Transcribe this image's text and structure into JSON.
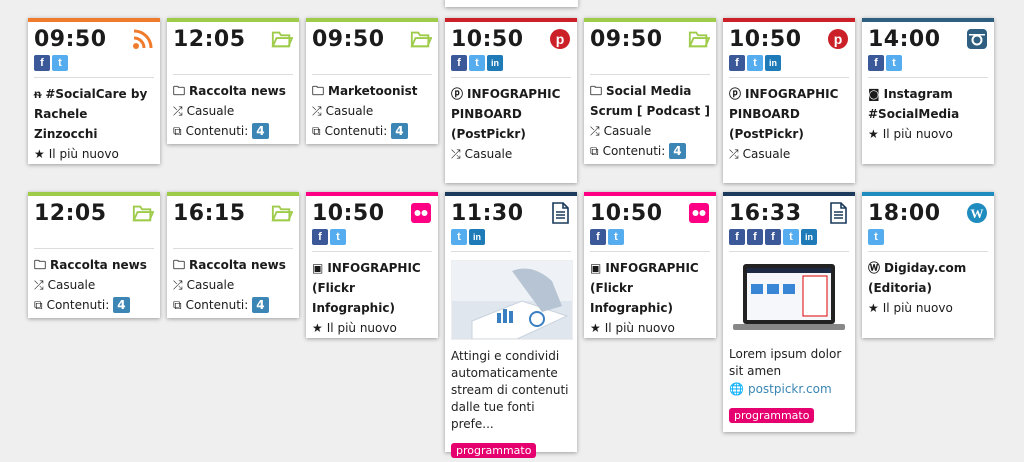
{
  "cards": {
    "c1": {
      "time": "09:50",
      "title1": "#SocialCare by",
      "title2": "Rachele Zinzocchi",
      "meta": "Il più nuovo"
    },
    "c2": {
      "time": "12:05",
      "title": "Raccolta news",
      "mode": "Casuale",
      "contenuti_label": "Contenuti:",
      "count": "4"
    },
    "c3": {
      "time": "09:50",
      "title": "Marketoonist",
      "mode": "Casuale",
      "contenuti_label": "Contenuti:",
      "count": "4"
    },
    "c4": {
      "time": "10:50",
      "title1": "INFOGRAPHIC",
      "title2": "PINBOARD",
      "title3": "(PostPickr)",
      "mode": "Casuale"
    },
    "c5": {
      "time": "09:50",
      "title1": "Social Media",
      "title2": "Scrum [ Podcast ]",
      "mode": "Casuale",
      "contenuti_label": "Contenuti:",
      "count": "4"
    },
    "c6": {
      "time": "10:50",
      "title1": "INFOGRAPHIC",
      "title2": "PINBOARD",
      "title3": "(PostPickr)",
      "mode": "Casuale"
    },
    "c7": {
      "time": "14:00",
      "title1": "Instagram",
      "title2": "#SocialMedia",
      "meta": "Il più nuovo"
    },
    "c8": {
      "time": "12:05",
      "title": "Raccolta news",
      "mode": "Casuale",
      "contenuti_label": "Contenuti:",
      "count": "4"
    },
    "c9": {
      "time": "16:15",
      "title": "Raccolta news",
      "mode": "Casuale",
      "contenuti_label": "Contenuti:",
      "count": "4"
    },
    "c10": {
      "time": "10:50",
      "title1": "INFOGRAPHIC",
      "title2": "(Flickr Infographic)",
      "meta": "Il più nuovo"
    },
    "c11": {
      "time": "11:30",
      "desc": "Attingi e condividi automaticamente stream di contenuti dalle tue fonti prefe...",
      "status": "programmato"
    },
    "c12": {
      "time": "10:50",
      "title1": "INFOGRAPHIC",
      "title2": "(Flickr Infographic)",
      "meta": "Il più nuovo"
    },
    "c13": {
      "time": "16:33",
      "desc": "Lorem ipsum dolor sit amen",
      "link": "postpickr.com",
      "status": "programmato"
    },
    "c14": {
      "time": "18:00",
      "title1": "Digiday.com",
      "title2": "(Editoria)",
      "meta": "Il più nuovo"
    }
  },
  "colors": {
    "rss": "#f07b2d",
    "folder": "#9fcb4b",
    "pinterest": "#cb2027",
    "instagram": "#2e5e80",
    "flickr": "#ff0084",
    "document": "#1b3a5c",
    "wordpress": "#1e8cbe",
    "badge": "#3b86b4",
    "status": "#e6006f"
  }
}
